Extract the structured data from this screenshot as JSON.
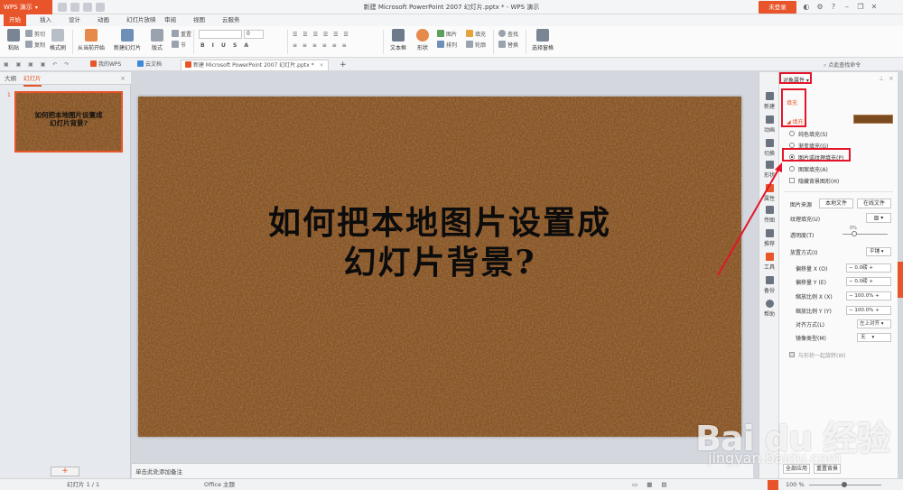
{
  "app": {
    "name": "WPS 演示",
    "window_title": "新建 Microsoft PowerPoint 2007 幻灯片.pptx * - WPS 演示",
    "login_label": "未登录"
  },
  "ribbon_tabs": [
    "开始",
    "插入",
    "设计",
    "动画",
    "幻灯片放映",
    "审阅",
    "视图",
    "云服务"
  ],
  "ribbon": {
    "paste": "粘贴",
    "cut": "剪切",
    "copy": "复制",
    "format_painter": "格式刷",
    "from_current": "从当前开始",
    "new_slide": "新建幻灯片",
    "layout": "版式",
    "section": "节",
    "reset": "重置",
    "font_size": "0",
    "textbox": "文本框",
    "shape": "形状",
    "arrange": "排列",
    "picture": "图片",
    "fill": "填充",
    "outline": "轮廓",
    "find": "查找",
    "replace": "替换",
    "select_pane": "选择窗格"
  },
  "doc_tabs": [
    "我的WPS",
    "云文档",
    "新建 Microsoft PowerPoint 2007 幻灯片.pptx *"
  ],
  "command_search": "点此查找命令",
  "left_panel": {
    "tab_outline": "大纲",
    "tab_slides": "幻灯片",
    "close": "×",
    "slide_number": "1",
    "thumb_title_line1": "如何把本地图片设置成",
    "thumb_title_line2": "幻灯片背景?",
    "add": "+"
  },
  "slide": {
    "title_line1": "如何把本地图片设置成",
    "title_line2": "幻灯片背景?"
  },
  "notes_placeholder": "单击此处添加备注",
  "sidebar": [
    "新建",
    "动画",
    "切换",
    "形状",
    "属性",
    "传图",
    "推荐",
    "工具",
    "备份",
    "帮助"
  ],
  "pane": {
    "header": "对象属性",
    "section_tab": "填充",
    "fill_heading": "填充",
    "options": [
      "纯色填充(S)",
      "渐变填充(G)",
      "图片或纹理填充(P)",
      "图案填充(A)"
    ],
    "selected_option": "图片或纹理填充(P)",
    "hide_bg": "隐藏背景图形(H)",
    "picture_source": "图片来源",
    "local_file": "本地文件",
    "online_file": "在线文件",
    "texture_fill": "纹理填充(U)",
    "transparency": "透明度(T)",
    "transparency_value": "0%",
    "placement": "放置方式(I)",
    "placement_value": "平铺",
    "offset_x": "偏移量 X (O)",
    "offset_x_value": "0.0磅",
    "offset_y": "偏移量 Y (E)",
    "offset_y_value": "0.0磅",
    "scale_x": "缩放比例 X (X)",
    "scale_x_value": "100.0%",
    "scale_y": "缩放比例 Y (Y)",
    "scale_y_value": "100.0%",
    "align": "对齐方式(L)",
    "align_value": "左上对齐",
    "mirror": "镜像类型(M)",
    "mirror_value": "无",
    "rotate_with_shape": "与形状一起旋转(W)",
    "apply_all": "全部应用",
    "reset_bg": "重置背景"
  },
  "status": {
    "slide_counter": "幻灯片 1 / 1",
    "theme": "Office 主题",
    "zoom": "100 %"
  },
  "watermark": {
    "brand": "Bai du 经验",
    "url": "jingyan.baidu.com"
  },
  "colors": {
    "accent": "#e8552a",
    "highlight_box": "#e4152a",
    "slide_background": "#8a5424"
  }
}
